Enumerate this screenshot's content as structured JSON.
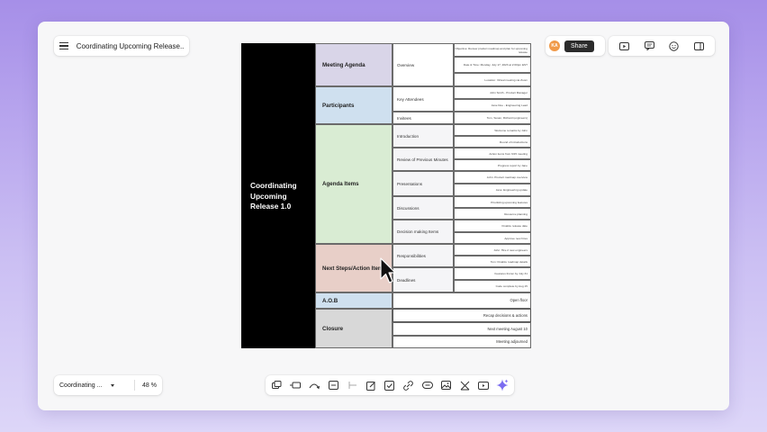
{
  "header": {
    "doc_title": "Coordinating Upcoming Release..."
  },
  "share": {
    "avatar_initials": "KA",
    "avatar_color": "#f09a4a",
    "share_label": "Share"
  },
  "top_icons": [
    "present-icon",
    "comment-icon",
    "emoji-icon",
    "panel-icon"
  ],
  "footer": {
    "page_label": "Coordinating ...",
    "zoom": "48 %"
  },
  "toolbar_icons": [
    "frame-icon",
    "shape-icon",
    "connector-icon",
    "text-box-icon",
    "line-icon",
    "note-icon",
    "checklist-icon",
    "link-icon",
    "embed-icon",
    "image-icon",
    "table-icon",
    "media-icon",
    "ai-sparkle-icon"
  ],
  "slide": {
    "title": "Coordinating Upcoming Release 1.0",
    "categories": [
      {
        "label": "Meeting Agenda",
        "color": "#d9d5e8"
      },
      {
        "label": "Participants",
        "color": "#cfe0ef"
      },
      {
        "label": "Agenda Items",
        "color": "#d9ecd3"
      },
      {
        "label": "Next Steps/Action Items",
        "color": "#e8cfc8"
      },
      {
        "label": "A.O.B",
        "color": "#cfe0ef"
      },
      {
        "label": "Closure",
        "color": "#d8d8d8"
      }
    ],
    "subs": [
      "Overview",
      "Key Attendees",
      "Invitees",
      "Introduction",
      "Review of Previous Minutes",
      "Presentations",
      "Discussions",
      "Decision making Items",
      "Responsibilities",
      "Deadlines"
    ],
    "details": [
      "Objective: Review product roadmap and plan for upcoming release",
      "Date & Time: Monday, July 17, 2023 at 2:00pm EST",
      "Location: Virtual meeting via Zoom",
      "John Smith - Product Manager",
      "Jane Doe - Engineering Lead",
      "Tom, Susan, Richard (engineers)",
      "Welcome remarks by John",
      "Round of introductions",
      "Action items from 6/15 meeting",
      "Progress report by Jane",
      "John: Product roadmap overview",
      "Jane: Engineering update",
      "Prioritizing upcoming features",
      "Resource planning",
      "Finalize release date",
      "Approve new hires",
      "John: Hire 2 new engineers",
      "Tom: Finalize roadmap details",
      "Features frozen by July 31",
      "Code complete by Aug 15",
      "Open floor",
      "Recap decisions & actions",
      "Next meeting August 10",
      "Meeting adjourned"
    ]
  }
}
